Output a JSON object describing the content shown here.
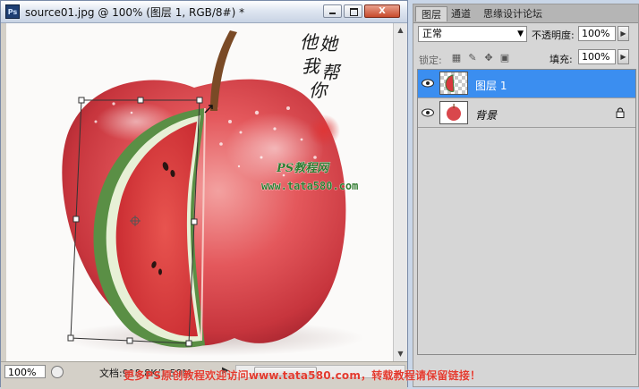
{
  "window": {
    "title": "source01.jpg @ 100% (图层 1, RGB/8#) *",
    "app_icon": "Ps",
    "controls": {
      "minimize": "minimize-icon",
      "maximize": "maximize-icon",
      "close": "X"
    }
  },
  "canvas": {
    "watermark_calligraphy": [
      "他",
      "她",
      "我",
      "帮",
      "你"
    ],
    "watermark_site": "PS教程网",
    "watermark_url": "www.tata580.com",
    "seal_icon": "red-seal-icon"
  },
  "status_bar": {
    "zoom": "100%",
    "doc_info": "文档:918.8K/1.59M"
  },
  "layers_panel": {
    "tabs": [
      {
        "label": "图层",
        "active": true
      },
      {
        "label": "通道",
        "active": false
      },
      {
        "label": "思缘设计论坛",
        "active": false
      }
    ],
    "blend_mode": "正常",
    "opacity_label": "不透明度:",
    "opacity_value": "100%",
    "lock_label": "锁定:",
    "fill_label": "填充:",
    "fill_value": "100%",
    "layers": [
      {
        "name": "图层 1",
        "selected": true,
        "visible": true,
        "locked": false
      },
      {
        "name": "背景",
        "selected": false,
        "visible": true,
        "locked": true
      }
    ]
  },
  "footer": {
    "text": "更多PS原创教程欢迎访问www.tata580.com，转载教程请保留链接！"
  },
  "colors": {
    "selection": "#3b8ef0",
    "apple_red": "#d9474c",
    "watermelon_red": "#d8373d",
    "rind_green": "#3f7c3a",
    "footer_red": "#e23a2e"
  }
}
